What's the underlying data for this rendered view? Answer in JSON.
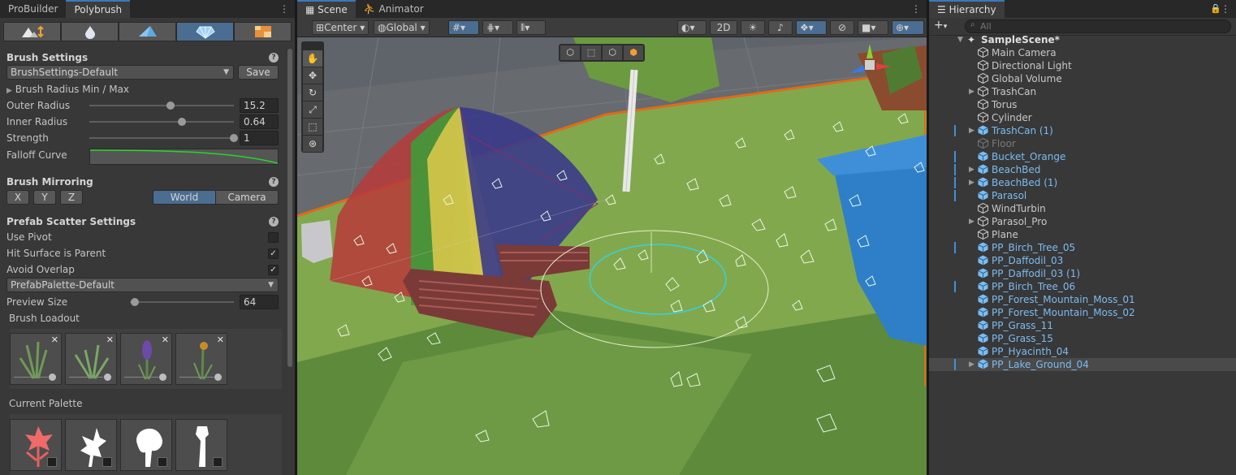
{
  "left": {
    "tabs": [
      "ProBuilder",
      "Polybrush"
    ],
    "active_tab": 1,
    "brush_settings": {
      "title": "Brush Settings",
      "preset": "BrushSettings-Default",
      "save_label": "Save",
      "radius_toggle": "Brush Radius Min / Max",
      "outer_radius_label": "Outer Radius",
      "outer_radius": "15.2",
      "outer_radius_fraction": 0.56,
      "inner_radius_label": "Inner Radius",
      "inner_radius": "0.64",
      "inner_radius_fraction": 0.64,
      "strength_label": "Strength",
      "strength": "1",
      "strength_fraction": 1.0,
      "falloff_label": "Falloff Curve"
    },
    "mirroring": {
      "title": "Brush Mirroring",
      "axes": [
        "X",
        "Y",
        "Z"
      ],
      "space": [
        "World",
        "Camera"
      ]
    },
    "scatter": {
      "title": "Prefab Scatter Settings",
      "use_pivot_label": "Use Pivot",
      "use_pivot": false,
      "hit_surface_label": "Hit Surface is Parent",
      "hit_surface": true,
      "avoid_overlap_label": "Avoid Overlap",
      "avoid_overlap": true,
      "palette": "PrefabPalette-Default",
      "preview_size_label": "Preview Size",
      "preview_size": "64",
      "preview_size_fraction": 0.05,
      "loadout_label": "Brush Loadout",
      "current_palette_label": "Current Palette",
      "remove_glyph": "✕"
    }
  },
  "scene": {
    "tabs": [
      "Scene",
      "Animator"
    ],
    "active_tab": 0,
    "pivot_mode": "Center",
    "pivot_space": "Global",
    "mode_2d": "2D"
  },
  "hierarchy": {
    "tab": "Hierarchy",
    "search_placeholder": "All",
    "scene_name": "SampleScene*",
    "items": [
      {
        "label": "Main Camera",
        "type": "go",
        "fold": false,
        "mark": false
      },
      {
        "label": "Directional Light",
        "type": "go",
        "fold": false,
        "mark": false
      },
      {
        "label": "Global Volume",
        "type": "go",
        "fold": false,
        "mark": false
      },
      {
        "label": "TrashCan",
        "type": "go",
        "fold": true,
        "mark": false
      },
      {
        "label": "Torus",
        "type": "go",
        "fold": false,
        "mark": false
      },
      {
        "label": "Cylinder",
        "type": "go",
        "fold": false,
        "mark": false
      },
      {
        "label": "TrashCan (1)",
        "type": "prefab",
        "fold": true,
        "mark": true
      },
      {
        "label": "Floor",
        "type": "disabled",
        "fold": false,
        "mark": false
      },
      {
        "label": "Bucket_Orange",
        "type": "prefab",
        "fold": false,
        "mark": true
      },
      {
        "label": "BeachBed",
        "type": "prefab",
        "fold": true,
        "mark": true
      },
      {
        "label": "BeachBed (1)",
        "type": "prefab",
        "fold": true,
        "mark": true
      },
      {
        "label": "Parasol",
        "type": "prefab",
        "fold": false,
        "mark": true
      },
      {
        "label": "WindTurbin",
        "type": "go",
        "fold": false,
        "mark": false
      },
      {
        "label": "Parasol_Pro",
        "type": "go",
        "fold": true,
        "mark": false
      },
      {
        "label": "Plane",
        "type": "go",
        "fold": false,
        "mark": false
      },
      {
        "label": "PP_Birch_Tree_05",
        "type": "prefab",
        "fold": false,
        "mark": true
      },
      {
        "label": "PP_Daffodil_03",
        "type": "prefab",
        "fold": false,
        "mark": false
      },
      {
        "label": "PP_Daffodil_03 (1)",
        "type": "prefab",
        "fold": false,
        "mark": false
      },
      {
        "label": "PP_Birch_Tree_06",
        "type": "prefab",
        "fold": false,
        "mark": true
      },
      {
        "label": "PP_Forest_Mountain_Moss_01",
        "type": "prefab",
        "fold": false,
        "mark": false
      },
      {
        "label": "PP_Forest_Mountain_Moss_02",
        "type": "prefab",
        "fold": false,
        "mark": false
      },
      {
        "label": "PP_Grass_11",
        "type": "prefab",
        "fold": false,
        "mark": false
      },
      {
        "label": "PP_Grass_15",
        "type": "prefab",
        "fold": false,
        "mark": false
      },
      {
        "label": "PP_Hyacinth_04",
        "type": "prefab",
        "fold": false,
        "mark": false
      },
      {
        "label": "PP_Lake_Ground_04",
        "type": "prefab",
        "fold": true,
        "mark": true,
        "selected": true
      }
    ]
  },
  "colors": {
    "accent": "#4a6d91",
    "prefab_text": "#7bbcf2",
    "falloff_curve": "#27d627",
    "brush_ring": "#36d0e0"
  }
}
